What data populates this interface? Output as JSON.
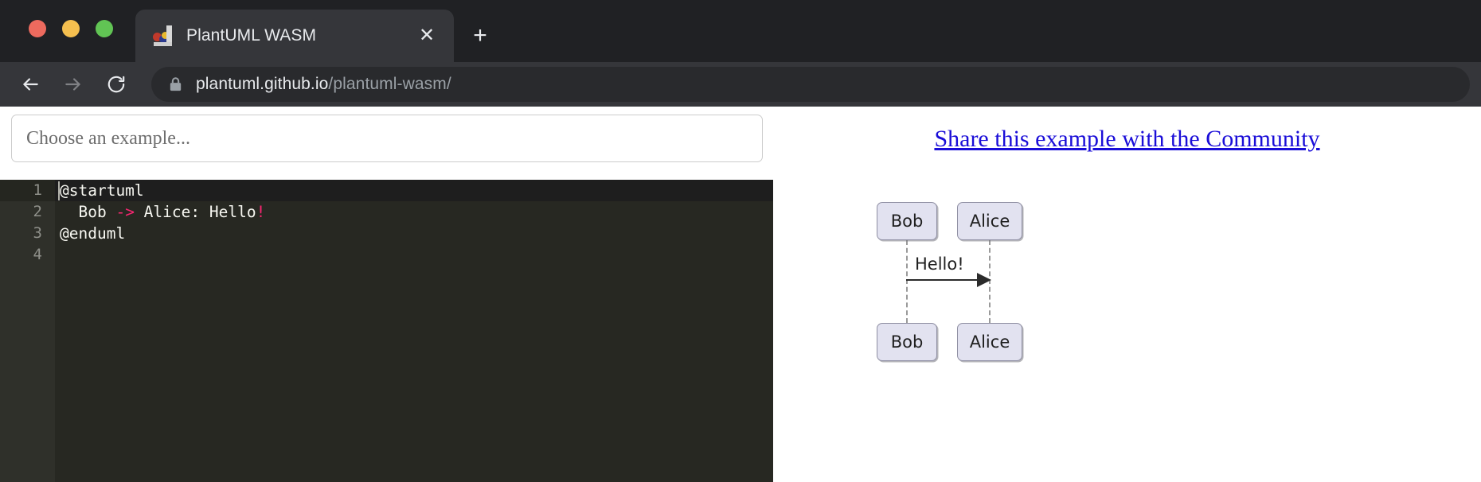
{
  "browser": {
    "traffic_lights": [
      "close",
      "minimize",
      "zoom"
    ],
    "tab": {
      "title": "PlantUML WASM",
      "favicon": "plantuml-favicon",
      "close_label": "✕"
    },
    "new_tab_label": "+",
    "nav": {
      "back": "back-arrow",
      "forward": "forward-arrow",
      "reload": "reload"
    },
    "omnibox": {
      "lock": "secure-lock",
      "host": "plantuml.github.io",
      "path": "/plantuml-wasm/",
      "full_url": "plantuml.github.io/plantuml-wasm/"
    }
  },
  "page": {
    "example_select": {
      "placeholder": "Choose an example...",
      "value": ""
    },
    "editor": {
      "lines": [
        {
          "number": "1",
          "active": true,
          "segments": [
            {
              "text": "@startuml",
              "cls": ""
            }
          ]
        },
        {
          "number": "2",
          "active": false,
          "segments": [
            {
              "text": "  Bob ",
              "cls": ""
            },
            {
              "text": "->",
              "cls": "tok-pink"
            },
            {
              "text": " Alice: Hello",
              "cls": ""
            },
            {
              "text": "!",
              "cls": "tok-pink"
            }
          ]
        },
        {
          "number": "3",
          "active": false,
          "segments": [
            {
              "text": "@enduml",
              "cls": ""
            }
          ]
        },
        {
          "number": "4",
          "active": false,
          "segments": [
            {
              "text": "",
              "cls": ""
            }
          ]
        }
      ],
      "line_1_text": "@startuml",
      "line_2_text": "  Bob -> Alice: Hello!",
      "line_3_text": "@enduml",
      "line_4_text": ""
    },
    "share_link": {
      "label": "Share this example with the Community"
    },
    "diagram": {
      "type": "sequence",
      "participants": [
        "Bob",
        "Alice"
      ],
      "bob_top_label": "Bob",
      "alice_top_label": "Alice",
      "bob_bottom_label": "Bob",
      "alice_bottom_label": "Alice",
      "messages": [
        {
          "from": "Bob",
          "to": "Alice",
          "label": "Hello!",
          "arrow": "solid"
        }
      ],
      "message_label": "Hello!"
    }
  },
  "colors": {
    "chrome_bg": "#202124",
    "toolbar_bg": "#35363a",
    "omnibox_bg": "#292a2d",
    "editor_bg": "#272822",
    "editor_active_line": "#1e1e1e",
    "gutter_bg": "#2f302a",
    "token_pink": "#f92672",
    "link_blue": "#1a0dd8",
    "participant_fill": "#e2e2f0",
    "participant_border": "#8f8fa3"
  }
}
